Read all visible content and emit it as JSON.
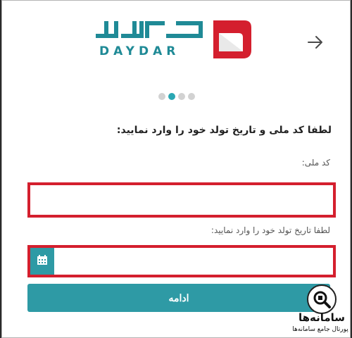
{
  "header": {
    "back_icon": "arrow-right-icon",
    "logo_persian": "دی دار",
    "logo_english": "DAYDAR",
    "brand_color": "#1f8a96",
    "logo_red": "#d41f2e"
  },
  "stepper": {
    "total_steps": 4,
    "current_step": 2
  },
  "form": {
    "instruction": "لطفا کد ملی و تاریخ تولد خود را وارد نمایید:",
    "national_code_label": "کد ملی:",
    "national_code_value": "",
    "birth_date_label": "لطفا تاریخ تولد خود را وارد نمایید:",
    "birth_date_value": "",
    "calendar_icon": "calendar-icon",
    "continue_label": "ادامه",
    "accent_color": "#2e9aa5"
  },
  "watermark": {
    "title": "سامانه‌ها",
    "subtitle": "پورتال جامع سامانه‌ها"
  }
}
